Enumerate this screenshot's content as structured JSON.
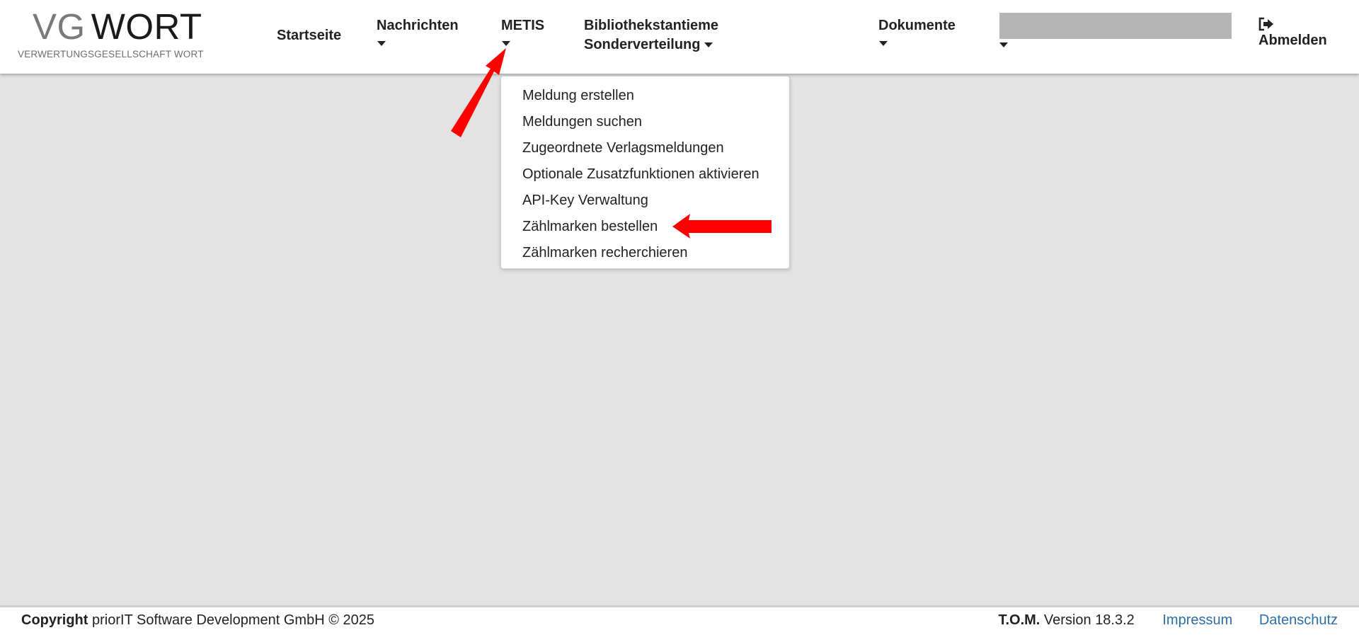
{
  "logo": {
    "vg": "VG",
    "wort": "WORT",
    "subtitle": "VERWERTUNGSGESELLSCHAFT WORT"
  },
  "nav": {
    "startseite": "Startseite",
    "nachrichten": "Nachrichten",
    "metis": "METIS",
    "bibliothek_line1": "Bibliothekstantieme",
    "bibliothek_line2": "Sonderverteilung",
    "dokumente": "Dokumente",
    "abmelden": "Abmelden"
  },
  "icons": {
    "caret": "caret-down-icon",
    "logout": "sign-out-icon"
  },
  "dropdown": {
    "items": [
      "Meldung erstellen",
      "Meldungen suchen",
      "Zugeordnete Verlagsmeldungen",
      "Optionale Zusatzfunktionen aktivieren",
      "API-Key Verwaltung",
      "Zählmarken bestellen",
      "Zählmarken recherchieren"
    ]
  },
  "annotations": {
    "color": "#ff0000"
  },
  "footer": {
    "copyright_label": "Copyright",
    "copyright_text": "priorIT Software Development GmbH © 2025",
    "tom_label": "T.O.M.",
    "version_text": "Version 18.3.2",
    "impressum": "Impressum",
    "datenschutz": "Datenschutz"
  },
  "colors": {
    "background": "#e3e3e3",
    "link": "#2b6ea6",
    "redacted": "#b5b5b5"
  }
}
